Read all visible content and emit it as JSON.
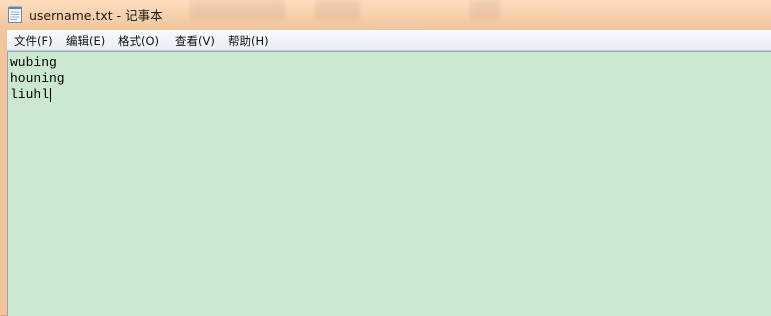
{
  "window": {
    "title": "username.txt - 记事本",
    "icon": "notepad-icon"
  },
  "menubar": {
    "items": [
      {
        "label": "文件(F)"
      },
      {
        "label": "编辑(E)"
      },
      {
        "label": "格式(O)"
      },
      {
        "label": "查看(V)"
      },
      {
        "label": "帮助(H)"
      }
    ]
  },
  "editor": {
    "background": "#cce9cf",
    "lines": [
      "wubing",
      "houning",
      "liuhl"
    ]
  }
}
